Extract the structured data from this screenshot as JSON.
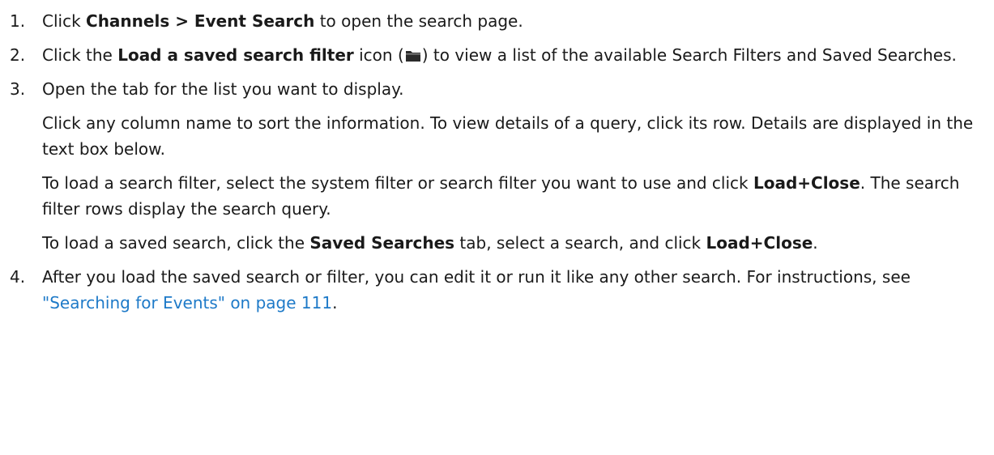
{
  "steps": [
    {
      "num": "1.",
      "parts": [
        {
          "text": "Click "
        },
        {
          "bold": "Channels > Event Search"
        },
        {
          "text": " to open the search page."
        }
      ]
    },
    {
      "num": "2.",
      "parts": [
        {
          "text": "Click the "
        },
        {
          "bold": "Load a saved search filter"
        },
        {
          "text": " icon ("
        },
        {
          "icon": "folder-icon"
        },
        {
          "text": ") to view a list of the available Search Filters and Saved Searches."
        }
      ]
    },
    {
      "num": "3.",
      "paragraphs": [
        [
          {
            "text": "Open the tab for the list you want to display."
          }
        ],
        [
          {
            "text": "Click any column name to sort the information. To view details of a query, click its row. Details are displayed in the text box below."
          }
        ],
        [
          {
            "text": "To load a search filter, select the system filter or search filter you want to use and click "
          },
          {
            "bold": "Load+Close"
          },
          {
            "text": ". The search filter rows display the search query."
          }
        ],
        [
          {
            "text": "To load a saved search, click the "
          },
          {
            "bold": "Saved Searches"
          },
          {
            "text": " tab, select a search, and click "
          },
          {
            "bold": "Load+Close"
          },
          {
            "text": "."
          }
        ]
      ]
    },
    {
      "num": "4.",
      "parts": [
        {
          "text": "After you load the saved search or filter, you can edit it or run it like any other search. For instructions, see "
        },
        {
          "link": "\"Searching for Events\" on page 111"
        },
        {
          "text": "."
        }
      ]
    }
  ],
  "colors": {
    "text": "#1a1a1a",
    "link": "#1e7ac8",
    "icon": "#2b2b2b"
  }
}
